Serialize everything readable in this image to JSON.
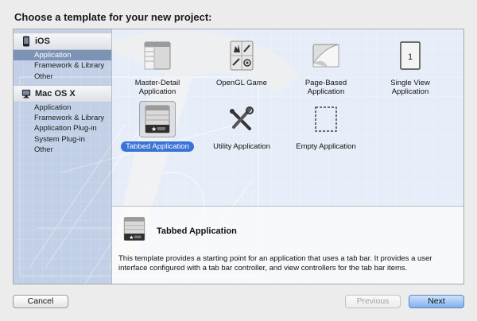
{
  "dialog": {
    "heading": "Choose a template for your new project:"
  },
  "sidebar": {
    "groups": [
      {
        "label": "iOS",
        "icon": "iphone-icon",
        "items": [
          "Application",
          "Framework & Library",
          "Other"
        ],
        "selected_index": 0
      },
      {
        "label": "Mac OS X",
        "icon": "mac-icon",
        "items": [
          "Application",
          "Framework & Library",
          "Application Plug-in",
          "System Plug-in",
          "Other"
        ],
        "selected_index": -1
      }
    ]
  },
  "templates": [
    {
      "label": "Master-Detail Application",
      "label_line1": "Master-Detail",
      "label_line2": "Application",
      "icon": "master-detail-icon"
    },
    {
      "label": "OpenGL Game",
      "label_line1": "OpenGL Game",
      "label_line2": "",
      "icon": "opengl-game-icon"
    },
    {
      "label": "Page-Based Application",
      "label_line1": "Page-Based",
      "label_line2": "Application",
      "icon": "page-curl-icon"
    },
    {
      "label": "Single View Application",
      "label_line1": "Single View",
      "label_line2": "Application",
      "icon": "single-view-icon"
    },
    {
      "label": "Tabbed Application",
      "label_line1": "Tabbed Application",
      "label_line2": "",
      "icon": "tab-bar-icon",
      "selected": true
    },
    {
      "label": "Utility Application",
      "label_line1": "Utility Application",
      "label_line2": "",
      "icon": "tools-icon"
    },
    {
      "label": "Empty Application",
      "label_line1": "Empty Application",
      "label_line2": "",
      "icon": "empty-dashed-icon"
    }
  ],
  "description": {
    "title": "Tabbed Application",
    "text": "This template provides a starting point for an application that uses a tab bar. It provides a user interface configured with a tab bar controller, and view controllers for the tab bar items.",
    "icon": "tab-bar-icon"
  },
  "buttons": {
    "cancel": "Cancel",
    "previous": "Previous",
    "next": "Next"
  },
  "colors": {
    "selection_sidebar": "#7d93b6",
    "selection_template": "#3a73d6",
    "blueprint": "#4f7fc9"
  }
}
